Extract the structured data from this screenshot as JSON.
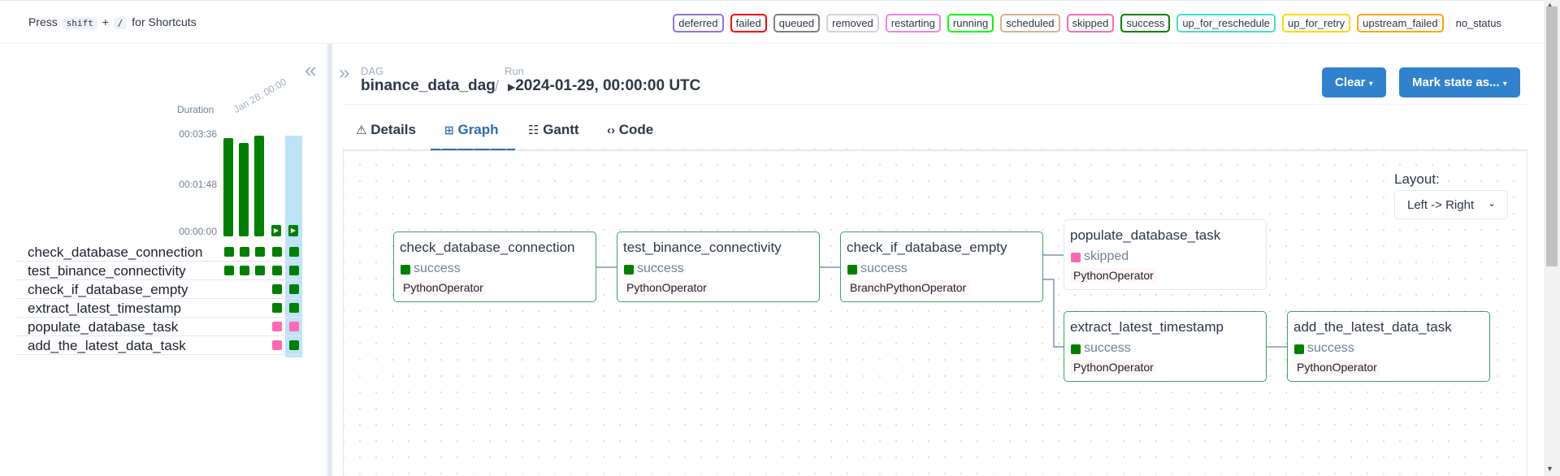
{
  "shortcuts": {
    "press": "Press",
    "key1": "shift",
    "plus": "+",
    "key2": "/",
    "suffix": "for Shortcuts"
  },
  "legend": [
    {
      "label": "deferred",
      "color": "#9370db"
    },
    {
      "label": "failed",
      "color": "#ff0000"
    },
    {
      "label": "queued",
      "color": "#808080"
    },
    {
      "label": "removed",
      "color": "#d3d3d3"
    },
    {
      "label": "restarting",
      "color": "#ee82ee"
    },
    {
      "label": "running",
      "color": "#00ff00"
    },
    {
      "label": "scheduled",
      "color": "#d2b48c"
    },
    {
      "label": "skipped",
      "color": "#ff69b4"
    },
    {
      "label": "success",
      "color": "#008000"
    },
    {
      "label": "up_for_reschedule",
      "color": "#40e0d0"
    },
    {
      "label": "up_for_retry",
      "color": "#ffd700"
    },
    {
      "label": "upstream_failed",
      "color": "#ffa500"
    },
    {
      "label": "no_status",
      "color": "transparent"
    }
  ],
  "grid": {
    "duration_label": "Duration",
    "ticks": [
      "00:03:36",
      "00:01:48",
      "00:00:00"
    ],
    "date_label": "Jan 28, 00:00",
    "tasks": [
      {
        "name": "check_database_connection",
        "states": [
          "success",
          "success",
          "success",
          "success",
          "success"
        ]
      },
      {
        "name": "test_binance_connectivity",
        "states": [
          "success",
          "success",
          "success",
          "success",
          "success"
        ]
      },
      {
        "name": "check_if_database_empty",
        "states": [
          "",
          "",
          "",
          "success",
          "success"
        ]
      },
      {
        "name": "extract_latest_timestamp",
        "states": [
          "",
          "",
          "",
          "success",
          "success"
        ]
      },
      {
        "name": "populate_database_task",
        "states": [
          "",
          "",
          "",
          "skipped",
          "skipped"
        ]
      },
      {
        "name": "add_the_latest_data_task",
        "states": [
          "",
          "",
          "",
          "skipped",
          "success"
        ]
      }
    ],
    "run_durations_fraction": [
      0.98,
      0.93,
      1.0,
      0.0,
      0.0
    ]
  },
  "header": {
    "dag_label": "DAG",
    "dag_name": "binance_data_dag",
    "separator": "/",
    "run_label": "Run",
    "run_value": "2024-01-29, 00:00:00 UTC",
    "clear_button": "Clear",
    "mark_button": "Mark state as..."
  },
  "tabs": [
    {
      "label": "Details",
      "icon": "warning-triangle-icon"
    },
    {
      "label": "Graph",
      "icon": "graph-icon"
    },
    {
      "label": "Gantt",
      "icon": "gantt-icon"
    },
    {
      "label": "Code",
      "icon": "code-icon"
    }
  ],
  "layout": {
    "label": "Layout:",
    "value": "Left -> Right"
  },
  "nodes": [
    {
      "name": "check_database_connection",
      "state": "success",
      "operator": "PythonOperator"
    },
    {
      "name": "test_binance_connectivity",
      "state": "success",
      "operator": "PythonOperator"
    },
    {
      "name": "check_if_database_empty",
      "state": "success",
      "operator": "BranchPythonOperator"
    },
    {
      "name": "populate_database_task",
      "state": "skipped",
      "operator": "PythonOperator"
    },
    {
      "name": "extract_latest_timestamp",
      "state": "success",
      "operator": "PythonOperator"
    },
    {
      "name": "add_the_latest_data_task",
      "state": "success",
      "operator": "PythonOperator"
    }
  ],
  "colors": {
    "success": "#008000",
    "skipped": "#ff69b4",
    "primary": "#3182ce"
  }
}
